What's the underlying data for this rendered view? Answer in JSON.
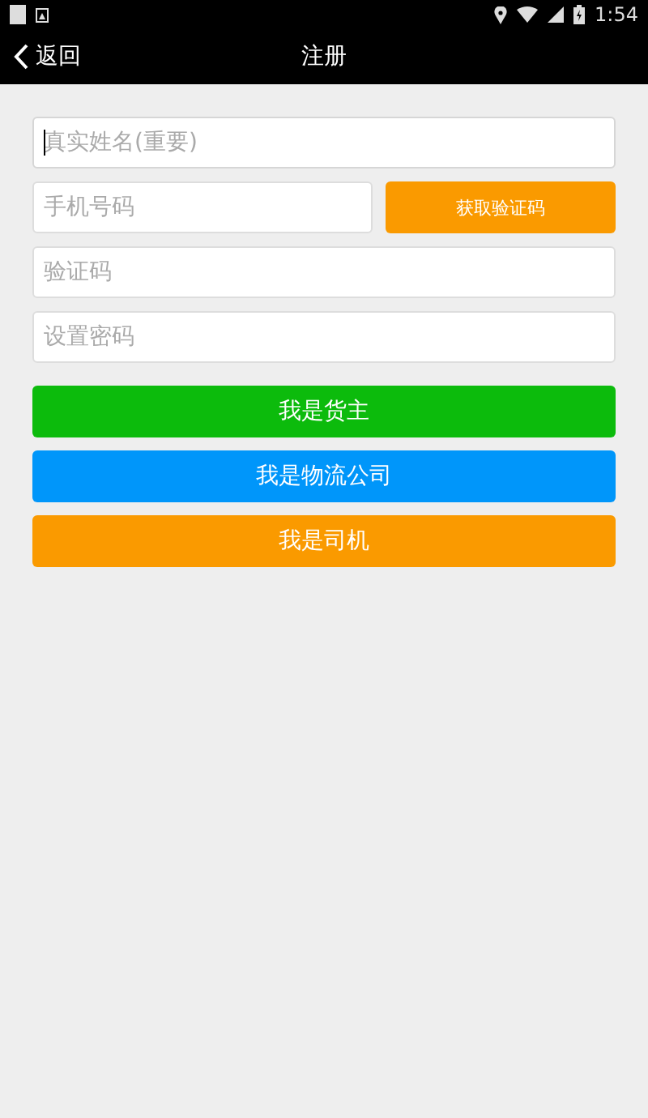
{
  "status_bar": {
    "time": "1:54"
  },
  "header": {
    "back_label": "返回",
    "title": "注册"
  },
  "fields": [
    {
      "placeholder": "真实姓名(重要)",
      "focused": true
    },
    {
      "placeholder": "手机号码",
      "focused": false,
      "action": "获取验证码"
    },
    {
      "placeholder": "验证码",
      "focused": false
    },
    {
      "placeholder": "设置密码",
      "focused": false
    }
  ],
  "role_buttons": [
    {
      "label": "我是货主",
      "color": "#0cbb0c"
    },
    {
      "label": "我是物流公司",
      "color": "#0096fa"
    },
    {
      "label": "我是司机",
      "color": "#fa9a00"
    }
  ]
}
